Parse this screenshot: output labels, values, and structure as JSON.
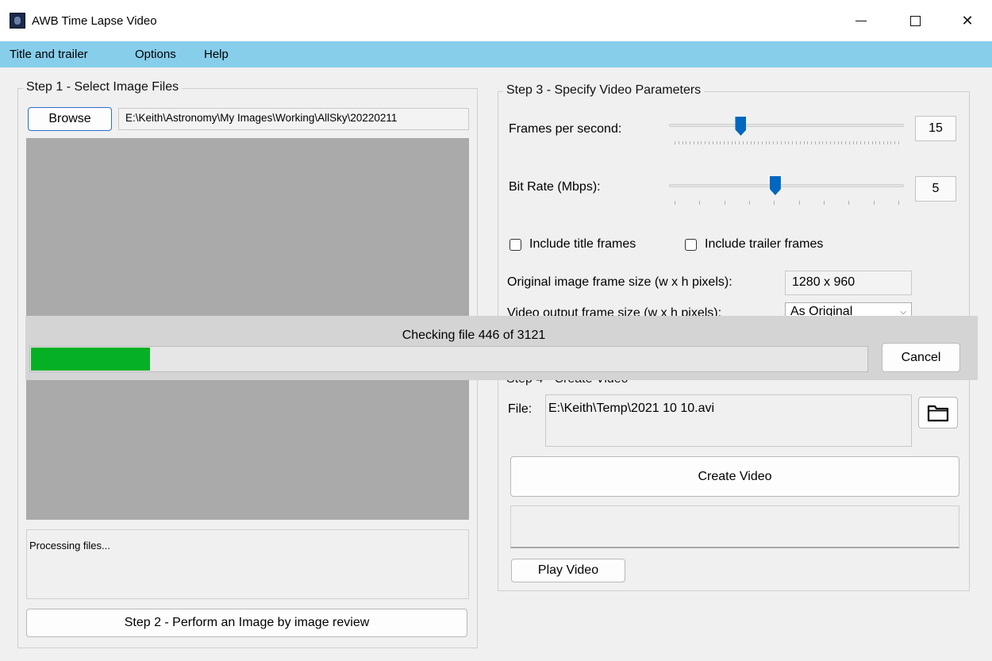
{
  "window": {
    "title": "AWB Time Lapse Video",
    "icons": [
      "app-icon",
      "minimize-icon",
      "maximize-icon",
      "close-icon"
    ]
  },
  "menu": [
    "Title and trailer",
    "Options",
    "Help"
  ],
  "step1": {
    "legend": "Step 1 - Select Image Files",
    "browse_label": "Browse",
    "path": "E:\\Keith\\Astronomy\\My Images\\Working\\AllSky\\20220211",
    "log_text": "Processing files..."
  },
  "step2": {
    "button_label": "Step 2 - Perform an Image by image review"
  },
  "step3": {
    "legend": "Step 3 - Specify Video Parameters",
    "fps_label": "Frames per second:",
    "fps_value": "15",
    "fps_fraction": 0.296,
    "bitrate_label": "Bit Rate (Mbps):",
    "bitrate_value": "5",
    "bitrate_fraction": 0.45,
    "include_title_label": "Include title frames",
    "include_trailer_label": "Include trailer frames",
    "orig_size_label": "Original image frame size (w x h pixels):",
    "orig_size_value": "1280 x 960",
    "output_size_label": "Video output frame size (w x h pixels):",
    "output_size_value": "As Original"
  },
  "progress": {
    "message": "Checking file 446 of 3121",
    "current": 446,
    "total": 3121,
    "cancel_label": "Cancel"
  },
  "step4": {
    "legend": "Step 4 - Create Video",
    "file_label": "File:",
    "file_path": "E:\\Keith\\Temp\\2021 10 10.avi",
    "create_label": "Create Video",
    "play_label": "Play Video"
  },
  "colors": {
    "menubar": "#87ceeb",
    "progress_fill": "#06b025",
    "slider_thumb": "#0067c0",
    "image_area": "#aaaaaa"
  }
}
